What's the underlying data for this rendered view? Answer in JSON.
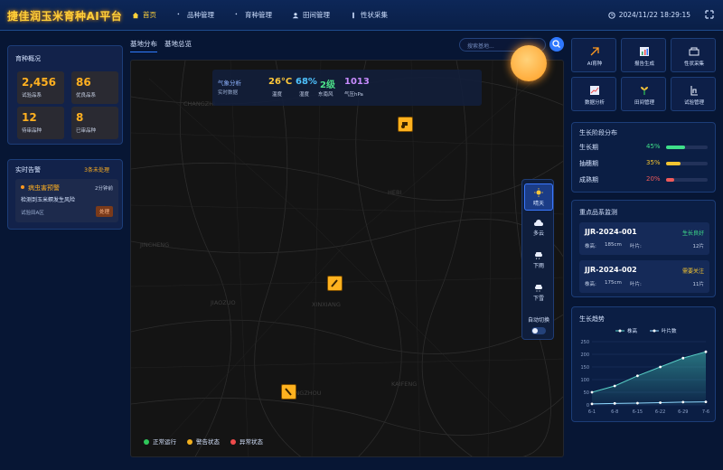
{
  "brand": "捷佳润玉米育种AI平台",
  "nav": [
    {
      "label": "首页",
      "icon": "home-icon",
      "active": true
    },
    {
      "label": "品种管理",
      "icon": "dna-icon"
    },
    {
      "label": "育种管理",
      "icon": "seedling-icon"
    },
    {
      "label": "田间管理",
      "icon": "user-icon"
    },
    {
      "label": "性状采集",
      "icon": "ruler-icon"
    }
  ],
  "clock": "2024/11/22 18:29:15",
  "overview": {
    "title": "育种概况",
    "stats": [
      {
        "value": "2,456",
        "label": "试验品系"
      },
      {
        "value": "86",
        "label": "优良品系"
      },
      {
        "value": "12",
        "label": "待审品种"
      },
      {
        "value": "8",
        "label": "已审品种"
      }
    ]
  },
  "alerts": {
    "title": "实时告警",
    "count_label": "3条未处理",
    "item": {
      "title": "病虫害预警",
      "time": "2分钟前",
      "desc": "检测到玉米螟发生风险",
      "location": "试验田A区",
      "action": "处理"
    }
  },
  "map_tabs": [
    "基地分布",
    "基地总览"
  ],
  "search": {
    "placeholder": "搜索基地..."
  },
  "weather": {
    "title": "气象分析",
    "subtitle": "实时数据",
    "items": [
      {
        "value": "26°C",
        "label": "温度",
        "color": "#ffc83a"
      },
      {
        "value": "68%",
        "label": "湿度",
        "color": "#4fc3ff"
      },
      {
        "value": "2级",
        "label": "东南风",
        "color": "#4de38a"
      },
      {
        "value": "1013",
        "label": "气压hPa",
        "color": "#c88cff"
      }
    ]
  },
  "map_labels": {
    "changzhi": "CHANGZHI",
    "jincheng": "JINCHENG",
    "xinxiang": "XINXIANG",
    "jiaozuo": "JIAOZUO",
    "kaifeng": "KAIFENG",
    "zhengzhou": "ZHENGZHOU",
    "hebi": "HEBI"
  },
  "weather_modes": [
    {
      "label": "晴天",
      "icon": "sun-icon",
      "active": true
    },
    {
      "label": "多云",
      "icon": "cloud-icon"
    },
    {
      "label": "下雨",
      "icon": "rain-icon"
    },
    {
      "label": "下雪",
      "icon": "snow-icon"
    }
  ],
  "auto_switch": "自动切换",
  "legend": [
    {
      "label": "正常运行",
      "color": "#2fc75a"
    },
    {
      "label": "警告状态",
      "color": "#f2b01e"
    },
    {
      "label": "异常状态",
      "color": "#ef4b4b"
    }
  ],
  "tools": [
    {
      "label": "AI育种",
      "icon": "ai-breeding-icon"
    },
    {
      "label": "报告生成",
      "icon": "report-icon"
    },
    {
      "label": "性状采集",
      "icon": "trait-icon"
    },
    {
      "label": "数据分析",
      "icon": "chart-icon"
    },
    {
      "label": "田间管理",
      "icon": "field-icon"
    },
    {
      "label": "试验管理",
      "icon": "experiment-icon"
    }
  ],
  "stages": {
    "title": "生长阶段分布",
    "items": [
      {
        "label": "生长期",
        "percent": "45%",
        "fraction": 0.45,
        "color": "#3fe08a"
      },
      {
        "label": "抽穗期",
        "percent": "35%",
        "fraction": 0.35,
        "color": "#f5c531"
      },
      {
        "label": "成熟期",
        "percent": "20%",
        "fraction": 0.2,
        "color": "#ef5a5a"
      }
    ]
  },
  "monitor": {
    "title": "重点品系监测",
    "cards": [
      {
        "code": "JJR-2024-001",
        "status": "生长良好",
        "status_color": "#3fe08a",
        "height_label": "株高:",
        "height": "185cm",
        "leaf_label": "叶片:",
        "leaf": "12片"
      },
      {
        "code": "JJR-2024-002",
        "status": "需要关注",
        "status_color": "#f5c531",
        "height_label": "株高:",
        "height": "175cm",
        "leaf_label": "叶片:",
        "leaf": "11片"
      }
    ]
  },
  "trend": {
    "title": "生长趋势"
  },
  "chart_data": {
    "type": "area",
    "x": [
      "6-1",
      "6-8",
      "6-15",
      "6-22",
      "6-29",
      "7-6"
    ],
    "series": [
      {
        "name": "株高",
        "values": [
          50,
          75,
          115,
          150,
          185,
          210
        ],
        "color": "#5ad1c8"
      },
      {
        "name": "叶片数",
        "values": [
          4,
          6,
          7,
          9,
          11,
          12
        ],
        "color": "#8fd8ff"
      }
    ],
    "ylim": [
      0,
      250
    ],
    "yticks": [
      0,
      50,
      100,
      150,
      200,
      250
    ],
    "legend": "top-center",
    "grid": true
  }
}
